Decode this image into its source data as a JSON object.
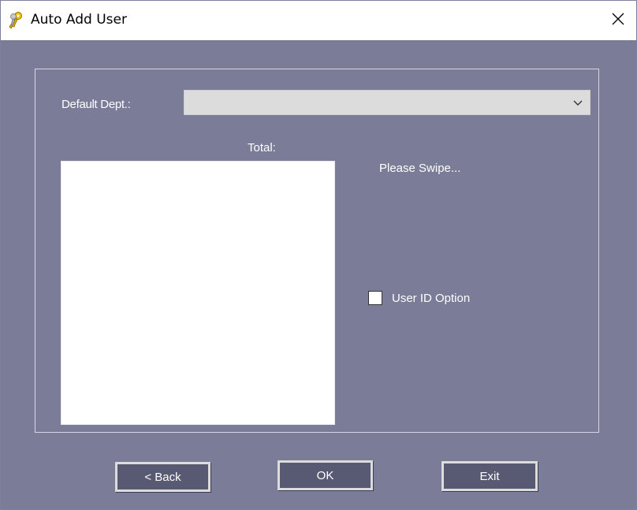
{
  "window": {
    "title": "Auto Add User"
  },
  "form": {
    "dept_label": "Default Dept.:",
    "dept_value": "",
    "total_label": "Total:",
    "swipe_message": "Please Swipe...",
    "user_id_option_label": "User ID Option",
    "user_id_option_checked": false
  },
  "buttons": {
    "back": "< Back",
    "ok": "OK",
    "exit": "Exit"
  },
  "icons": {
    "title": "keys-icon",
    "close": "close-icon",
    "dropdown": "chevron-down-icon"
  },
  "colors": {
    "background": "#7a7c98",
    "button": "#575a72",
    "button_border": "#dcdcdc"
  }
}
